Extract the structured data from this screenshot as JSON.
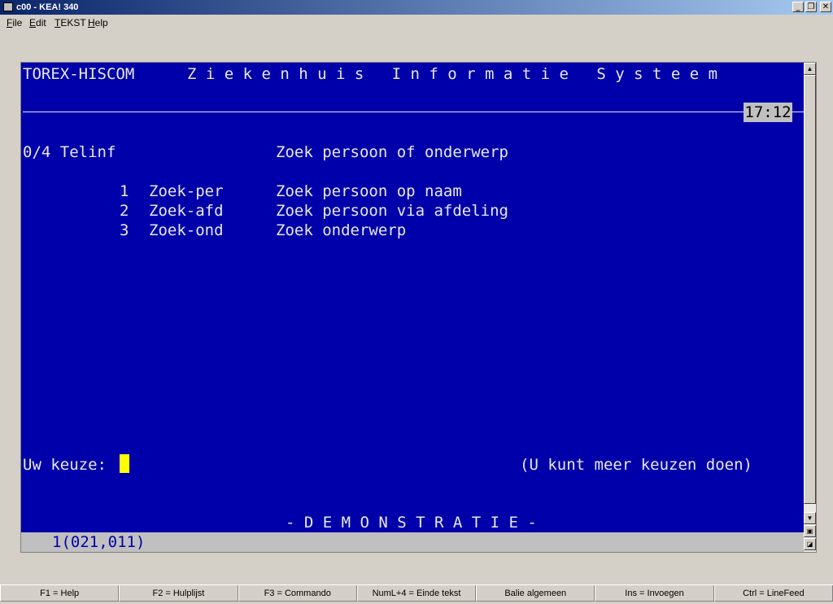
{
  "window": {
    "title": "c00 - KEA! 340",
    "controls": [
      "minimize-icon",
      "restore-icon",
      "close-icon"
    ]
  },
  "menu": [
    {
      "label": "File",
      "accel": "F",
      "rest": "ile"
    },
    {
      "label": "Edit",
      "accel": "E",
      "rest": "dit"
    },
    {
      "label": "TEKST",
      "accel": "T",
      "rest": "EKST"
    },
    {
      "label": "Help",
      "accel": "H",
      "rest": "elp"
    }
  ],
  "screen": {
    "system_name": "TOREX-HISCOM",
    "system_title": "Z i e k e n h u i s   I n f o r m a t i e   S y s t e e m",
    "clock": "17:12",
    "menu_code": "0/4 Telinf",
    "menu_title": "Zoek persoon of onderwerp",
    "options": [
      {
        "num": "1",
        "code": "Zoek-per",
        "desc": "Zoek persoon op naam"
      },
      {
        "num": "2",
        "code": "Zoek-afd",
        "desc": "Zoek persoon via afdeling"
      },
      {
        "num": "3",
        "code": "Zoek-ond",
        "desc": "Zoek onderwerp"
      }
    ],
    "prompt_label": "Uw keuze:",
    "prompt_hint": "(U kunt meer keuzen doen)",
    "banner": "- D E M O N S T R A T I E -",
    "status": "1(021,011)"
  },
  "function_keys": [
    "F1 = Help",
    "F2 = Hulplijst",
    "F3 = Commando",
    "NumL+4 = Einde tekst",
    "Balie algemeen",
    "Ins = Invoegen",
    "Ctrl = LineFeed"
  ]
}
